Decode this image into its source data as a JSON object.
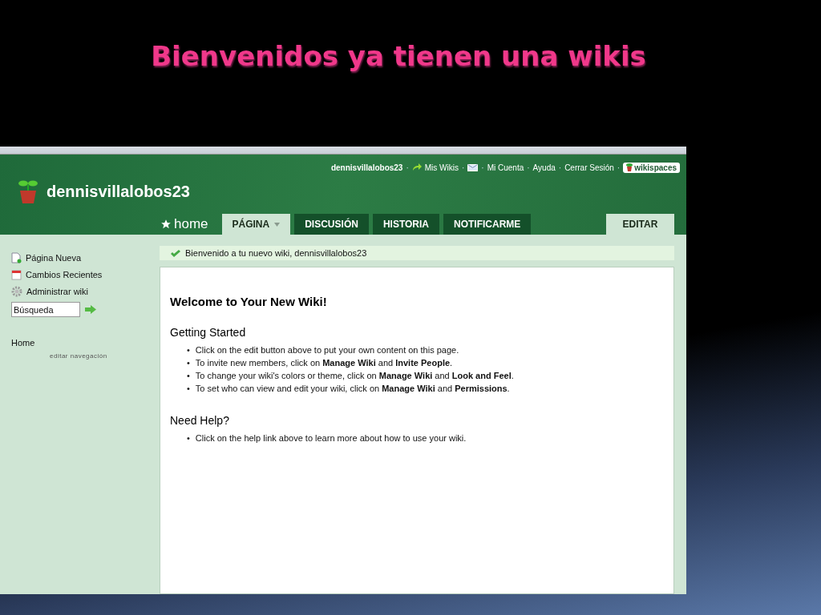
{
  "slide_title": "Bienvenidos ya tienen una wikis",
  "header": {
    "site_name": "dennisvillalobos23",
    "separator": "·",
    "user_links": [
      {
        "kind": "user",
        "label": "dennisvillalobos23"
      },
      {
        "kind": "wikis",
        "label": "Mis Wikis"
      },
      {
        "kind": "mail"
      },
      {
        "kind": "link",
        "label": "Mi Cuenta"
      },
      {
        "kind": "link",
        "label": "Ayuda"
      },
      {
        "kind": "link",
        "label": "Cerrar Sesión"
      },
      {
        "kind": "brand",
        "label": "wikispaces"
      }
    ],
    "home_label": "home",
    "tabs": [
      {
        "label": "PÁGINA",
        "selected": true,
        "dropdown": true
      },
      {
        "label": "DISCUSIÓN",
        "selected": false,
        "dropdown": false
      },
      {
        "label": "HISTORIA",
        "selected": false,
        "dropdown": false
      },
      {
        "label": "NOTIFICARME",
        "selected": false,
        "dropdown": false
      }
    ],
    "edit_button": "EDITAR"
  },
  "sidebar": {
    "items": [
      {
        "kind": "new-page",
        "label": "Página Nueva"
      },
      {
        "kind": "calendar",
        "label": "Cambios Recientes"
      },
      {
        "kind": "gear",
        "label": "Administrar wiki"
      }
    ],
    "search": {
      "placeholder": "Búsqueda"
    },
    "nav": [
      {
        "label": "Home"
      }
    ],
    "edit_nav": "editar navegación"
  },
  "bullet": "•",
  "notice": "Bienvenido a tu nuevo wiki, dennisvillalobos23",
  "content": {
    "title": "Welcome to Your New Wiki!",
    "sections": [
      {
        "heading": "Getting Started",
        "bullets": [
          "Click on the edit button above to put your own content on this page.",
          "To invite new members, click on **Manage Wiki** and **Invite People**.",
          "To change your wiki's colors or theme, click on **Manage Wiki** and **Look and Feel**.",
          "To set who can view and edit your wiki, click on **Manage Wiki** and **Permissions**."
        ]
      },
      {
        "heading": "Need Help?",
        "bullets": [
          "Click on the help link above to learn more about how to use your wiki."
        ]
      }
    ]
  }
}
